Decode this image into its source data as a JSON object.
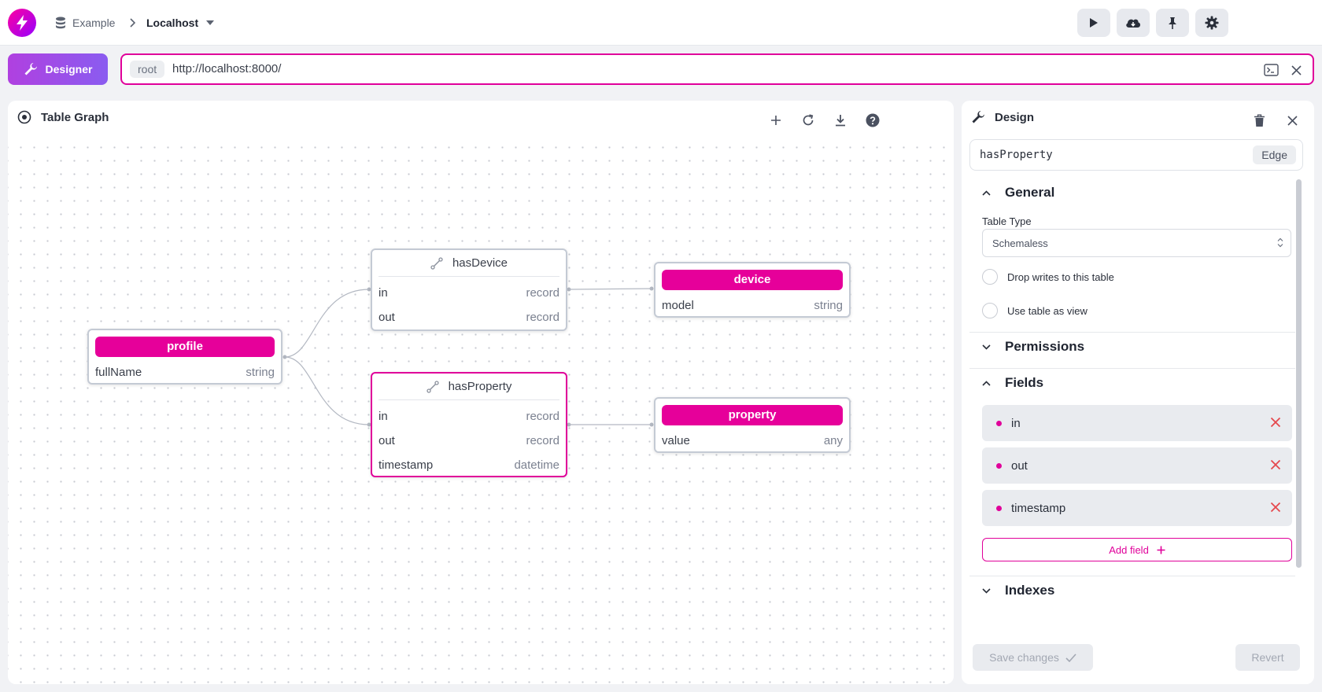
{
  "header": {
    "breadcrumb_namespace": "Example",
    "breadcrumb_connection": "Localhost",
    "icons": {
      "logo": "bolt-logo-icon",
      "namespace": "database-icon",
      "separator": "chevron-right-icon",
      "connection_menu": "caret-down-icon",
      "run": "play-icon",
      "sync": "cloud-download-icon",
      "pin": "pin-icon",
      "settings": "gear-icon"
    }
  },
  "toolbar": {
    "mode_label": "Designer",
    "mode_icon": "wrench-icon",
    "namespace_badge": "root",
    "url": "http://localhost:8000/",
    "icons": [
      "terminal-icon",
      "close-icon"
    ]
  },
  "graph": {
    "title": "Table Graph",
    "icons": [
      "target-icon",
      "plus-icon",
      "refresh-icon",
      "download-icon",
      "help-icon"
    ],
    "nodes": {
      "profile": {
        "name": "profile",
        "kind": "table",
        "fields": [
          {
            "name": "fullName",
            "type": "string"
          }
        ]
      },
      "hasDevice": {
        "name": "hasDevice",
        "kind": "edge",
        "fields": [
          {
            "name": "in",
            "type": "record"
          },
          {
            "name": "out",
            "type": "record"
          }
        ]
      },
      "hasProperty": {
        "name": "hasProperty",
        "kind": "edge",
        "selected": true,
        "fields": [
          {
            "name": "in",
            "type": "record"
          },
          {
            "name": "out",
            "type": "record"
          },
          {
            "name": "timestamp",
            "type": "datetime"
          }
        ]
      },
      "device": {
        "name": "device",
        "kind": "table",
        "fields": [
          {
            "name": "model",
            "type": "string"
          }
        ]
      },
      "property": {
        "name": "property",
        "kind": "table",
        "fields": [
          {
            "name": "value",
            "type": "any"
          }
        ]
      }
    }
  },
  "design": {
    "title": "Design",
    "table_name": "hasProperty",
    "table_kind": "Edge",
    "general": {
      "title": "General",
      "table_type_label": "Table Type",
      "table_type_value": "Schemaless",
      "drop_label": "Drop writes to this table",
      "drop_checked": false,
      "view_label": "Use table as view",
      "view_checked": false
    },
    "permissions_title": "Permissions",
    "fields_title": "Fields",
    "fields": [
      "in",
      "out",
      "timestamp"
    ],
    "add_field_label": "Add field",
    "indexes_title": "Indexes",
    "save_label": "Save changes",
    "revert_label": "Revert"
  },
  "colors": {
    "accent": "#e0009a",
    "brand_gradient_start": "#ff00a0",
    "brand_gradient_end": "#9600ff",
    "designer_button": "#a24be8",
    "delete_x": "#e5484d"
  }
}
